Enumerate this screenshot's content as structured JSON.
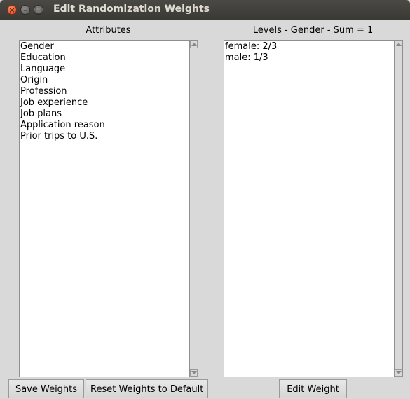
{
  "window": {
    "title": "Edit Randomization Weights"
  },
  "attributes": {
    "label": "Attributes",
    "items": [
      "Gender",
      "Education",
      "Language",
      "Origin",
      "Profession",
      "Job experience",
      "Job plans",
      "Application reason",
      "Prior trips to U.S."
    ]
  },
  "levels": {
    "label": "Levels - Gender - Sum = 1",
    "items": [
      "female: 2/3",
      "male: 1/3"
    ]
  },
  "buttons": {
    "save": "Save Weights",
    "reset": "Reset Weights to Default",
    "edit": "Edit Weight"
  }
}
